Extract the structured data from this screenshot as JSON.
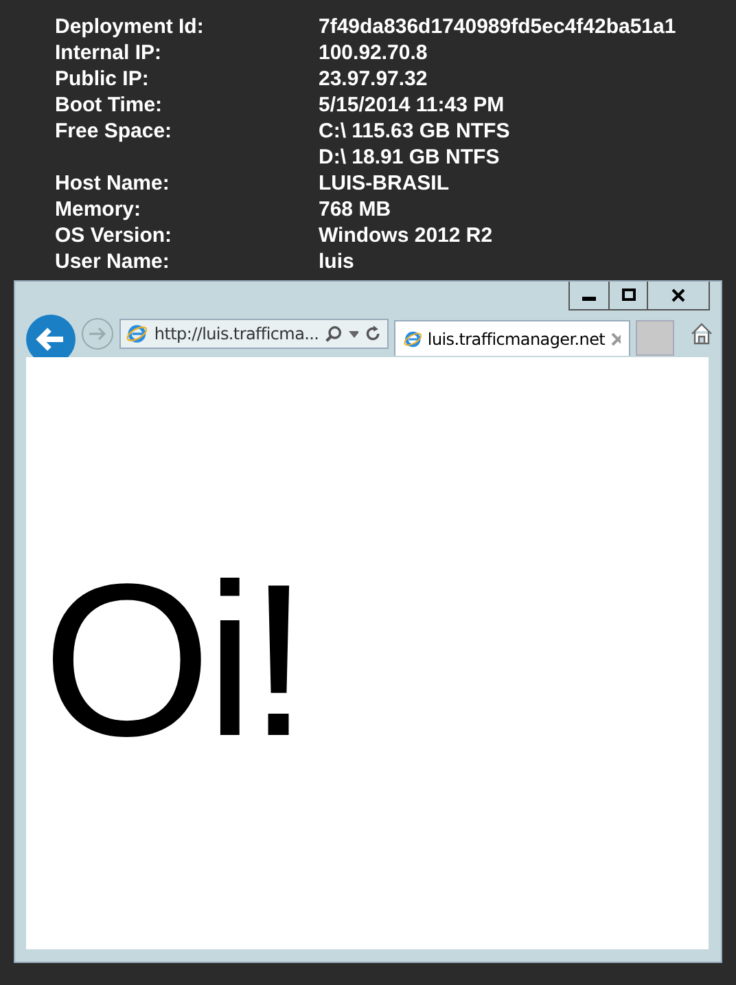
{
  "info": [
    {
      "label": "Deployment Id:",
      "values": [
        "7f49da836d1740989fd5ec4f42ba51a1"
      ]
    },
    {
      "label": "Internal IP:",
      "values": [
        "100.92.70.8"
      ]
    },
    {
      "label": "Public IP:",
      "values": [
        "23.97.97.32"
      ]
    },
    {
      "label": "Boot Time:",
      "values": [
        "5/15/2014 11:43 PM"
      ]
    },
    {
      "label": "Free Space:",
      "values": [
        "C:\\ 115.63 GB NTFS",
        "D:\\ 18.91 GB NTFS"
      ]
    },
    {
      "label": "Host Name:",
      "values": [
        "LUIS-BRASIL"
      ]
    },
    {
      "label": "Memory:",
      "values": [
        "768 MB"
      ]
    },
    {
      "label": "OS Version:",
      "values": [
        "Windows 2012 R2"
      ]
    },
    {
      "label": "User Name:",
      "values": [
        "luis"
      ]
    }
  ],
  "browser": {
    "address": "http://luis.trafficma...",
    "tab": {
      "title": "luis.trafficmanager.net",
      "selected": true
    },
    "page_text": "Oi!"
  }
}
